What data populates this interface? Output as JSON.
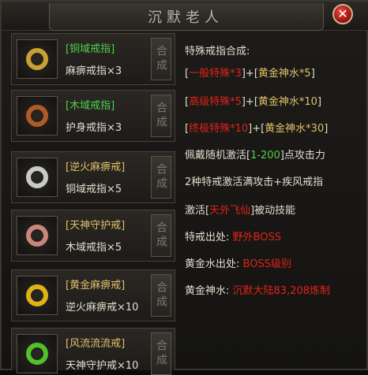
{
  "window": {
    "title": "沉默老人",
    "close_glyph": "✕"
  },
  "craft_label": "合成",
  "items": [
    {
      "name": "[铜域戒指]",
      "material": "麻痹戒指×3",
      "name_color": "#4fd04a",
      "ring_color": "#caa032",
      "icon": "copper-domain-ring-icon"
    },
    {
      "name": "[木域戒指]",
      "material": "护身戒指×3",
      "name_color": "#4fd04a",
      "ring_color": "#b25a24",
      "icon": "wood-domain-ring-icon"
    },
    {
      "name": "[逆火麻痹戒]",
      "material": "铜域戒指×5",
      "name_color": "#e0c06a",
      "ring_color": "#c9c9c9",
      "icon": "reverse-fire-paralysis-ring-icon"
    },
    {
      "name": "[天神守护戒]",
      "material": "木域戒指×5",
      "name_color": "#e0c06a",
      "ring_color": "#c8867a",
      "icon": "god-guardian-ring-icon"
    },
    {
      "name": "[黄金麻痹戒]",
      "material": "逆火麻痹戒×10",
      "name_color": "#e0c06a",
      "ring_color": "#e0b218",
      "icon": "golden-paralysis-ring-icon"
    },
    {
      "name": "[风流流流戒]",
      "material": "天神守护戒×10",
      "name_color": "#e0c06a",
      "ring_color": "#52c22a",
      "icon": "wind-ring-icon"
    }
  ],
  "info": {
    "heading": "特殊戒指合成:",
    "recipe1": {
      "a": "[",
      "b": "一般特殊*3",
      "c": "]+[",
      "d": "黄金神水*5",
      "e": "]"
    },
    "recipe2": {
      "a": "[",
      "b": "高级特殊*5",
      "c": "]+[",
      "d": "黄金神水*10",
      "e": "]"
    },
    "recipe3": {
      "a": "[",
      "b": "终极特殊*10",
      "c": "]+[",
      "d": "黄金神水*30",
      "e": "]"
    },
    "wear": {
      "a": "佩戴随机激活[",
      "b": "1-200",
      "c": "]点攻击力"
    },
    "activate2": "2种特戒激活满攻击+疾风戒指",
    "activate": {
      "a": "激活[",
      "b": "天外飞仙",
      "c": "]被动技能"
    },
    "special_source": {
      "label": "特戒出处:",
      "value": "野外BOSS"
    },
    "gold_source": {
      "label": "黄金水出处:",
      "value": "BOSS级别"
    },
    "gold_holy": {
      "label": "黄金神水:",
      "value": "沉默大陆83,208炼制"
    }
  }
}
